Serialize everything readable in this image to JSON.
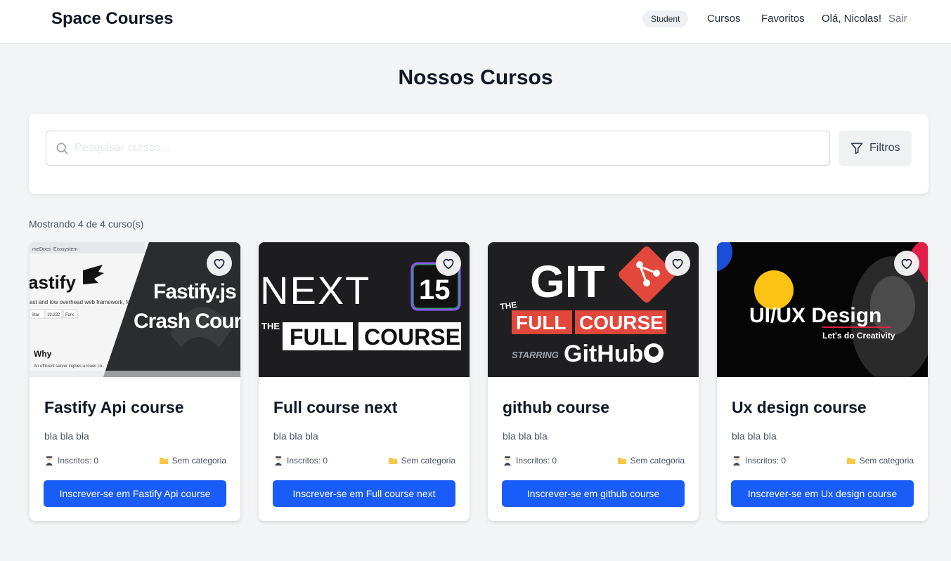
{
  "header": {
    "brand": "Space Courses",
    "role_badge": "Student",
    "nav": {
      "cursos": "Cursos",
      "favoritos": "Favoritos"
    },
    "greeting": "Olá, Nicolas!",
    "logout": "Sair"
  },
  "page": {
    "title": "Nossos Cursos"
  },
  "search": {
    "placeholder": "Pesquisar cursos...",
    "value": "",
    "filter_label": "Filtros"
  },
  "results": {
    "count_text": "Mostrando 4 de 4 curso(s)"
  },
  "courses": [
    {
      "title": "Fastify Api course",
      "description": "bla bla bla",
      "enrolled": "Inscritos: 0",
      "category": "Sem categoria",
      "button": "Inscrever-se em Fastify Api course",
      "thumb": {
        "line1": "Fastify.js",
        "line2": "Crash Cour",
        "site_logo": "astify",
        "site_tagline": "ast and low overhead web framework, for",
        "site_nav": [
          "me",
          "Docs",
          "Ecosystem"
        ],
        "site_buttons": [
          "Star",
          "19,232",
          "Fork"
        ],
        "site_heading": "Why",
        "site_body": "An efficient server implies a lower co... you are serving the highest number"
      }
    },
    {
      "title": "Full course next",
      "description": "bla bla bla",
      "enrolled": "Inscritos: 0",
      "category": "Sem categoria",
      "button": "Inscrever-se em Full course next",
      "thumb": {
        "word": "NEXT",
        "version": "15",
        "prefix": "THE",
        "line1": "FULL",
        "line2": "COURSE"
      }
    },
    {
      "title": "github course",
      "description": "bla bla bla",
      "enrolled": "Inscritos: 0",
      "category": "Sem categoria",
      "button": "Inscrever-se em github course",
      "thumb": {
        "word": "GIT",
        "prefix": "THE",
        "line1": "FULL",
        "line2": "COURSE",
        "starring": "STARRING",
        "brand": "GitHub"
      }
    },
    {
      "title": "Ux design course",
      "description": "bla bla bla",
      "enrolled": "Inscritos: 0",
      "category": "Sem categoria",
      "button": "Inscrever-se em Ux design course",
      "thumb": {
        "headline": "UI/UX Design",
        "tagline": "Let's do Creativity"
      }
    }
  ],
  "colors": {
    "primary": "#1a5cf7",
    "background": "#f3f4f6",
    "thumb_dark": "#1f2022",
    "git_orange": "#e2473b",
    "next_accent": "#7c3aed",
    "ux_yellow": "#fcc314",
    "ux_pink": "#e11d48"
  },
  "icons": {
    "search": "search-icon",
    "filter": "filter-icon",
    "favorite": "heart-outline-icon",
    "enrolled": "student-icon",
    "category": "folder-icon"
  }
}
